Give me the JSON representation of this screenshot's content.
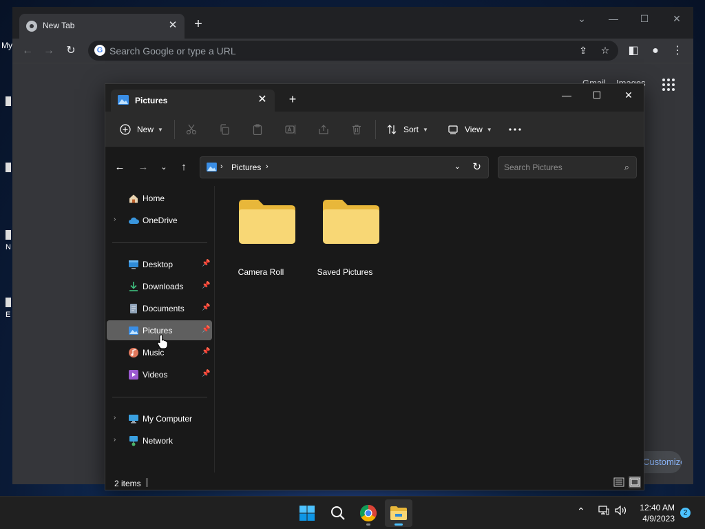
{
  "desktop": {
    "partial_label_1": "My",
    "partial_label_2": "N",
    "partial_label_3": "E"
  },
  "chrome": {
    "tab_title": "New Tab",
    "omnibox_placeholder": "Search Google or type a URL",
    "links": [
      "Gmail",
      "Images"
    ],
    "customize_label": "Customize Chrome"
  },
  "explorer": {
    "tab_title": "Pictures",
    "ribbon": {
      "new_label": "New",
      "sort_label": "Sort",
      "view_label": "View"
    },
    "address": {
      "crumb": "Pictures"
    },
    "search_placeholder": "Search Pictures",
    "nav": {
      "home": "Home",
      "onedrive": "OneDrive",
      "desktop": "Desktop",
      "downloads": "Downloads",
      "documents": "Documents",
      "pictures": "Pictures",
      "music": "Music",
      "videos": "Videos",
      "my_computer": "My Computer",
      "network": "Network"
    },
    "folders": [
      {
        "name": "Camera Roll"
      },
      {
        "name": "Saved Pictures"
      }
    ],
    "status": {
      "item_count": "2 items"
    }
  },
  "taskbar": {
    "time": "12:40 AM",
    "date": "4/9/2023",
    "notification_count": "2"
  },
  "colors": {
    "accent": "#4cc2ff",
    "folder_yellow": "#f8d775",
    "folder_dark": "#e8b73a",
    "selected_bg": "#5f5f5f"
  }
}
